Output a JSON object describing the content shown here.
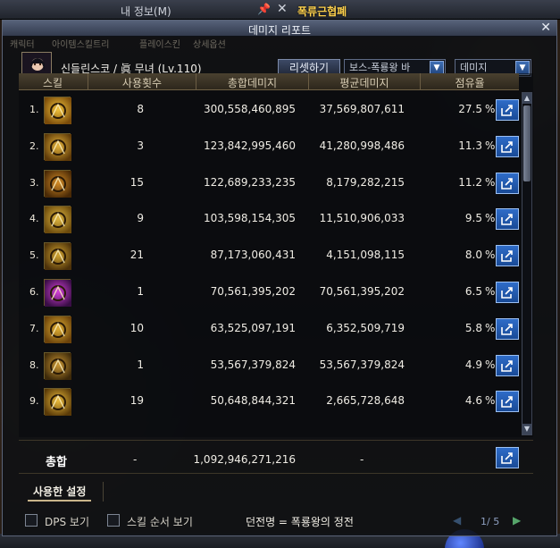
{
  "background": {
    "window_title": "내 정보(M)",
    "npc_name": "폭류근협폐",
    "ghost_tabs": [
      "캐릭터",
      "아이템스킬트리",
      "플레이스킨",
      "상세옵션"
    ]
  },
  "window": {
    "title": "데미지 리포트",
    "close": "✕"
  },
  "header": {
    "character": "신들린스코 / 眞 무녀 (Lv.110)",
    "reset_label": "리셋하기",
    "filter_value": "보스-폭룡왕 바",
    "metric_value": "데미지"
  },
  "table": {
    "columns": [
      "스킬",
      "사용횟수",
      "총합데미지",
      "평균데미지",
      "점유율"
    ],
    "rows": [
      {
        "rank": "1.",
        "icon": "skill-icon-1",
        "uses": "8",
        "total": "300,558,460,895",
        "avg": "37,569,807,611",
        "share": "27.5",
        "pct": "%"
      },
      {
        "rank": "2.",
        "icon": "skill-icon-2",
        "uses": "3",
        "total": "123,842,995,460",
        "avg": "41,280,998,486",
        "share": "11.3",
        "pct": "%"
      },
      {
        "rank": "3.",
        "icon": "skill-icon-3",
        "uses": "15",
        "total": "122,689,233,235",
        "avg": "8,179,282,215",
        "share": "11.2",
        "pct": "%"
      },
      {
        "rank": "4.",
        "icon": "skill-icon-4",
        "uses": "9",
        "total": "103,598,154,305",
        "avg": "11,510,906,033",
        "share": "9.5",
        "pct": "%"
      },
      {
        "rank": "5.",
        "icon": "skill-icon-5",
        "uses": "21",
        "total": "87,173,060,431",
        "avg": "4,151,098,115",
        "share": "8.0",
        "pct": "%"
      },
      {
        "rank": "6.",
        "icon": "skill-icon-6",
        "uses": "1",
        "total": "70,561,395,202",
        "avg": "70,561,395,202",
        "share": "6.5",
        "pct": "%"
      },
      {
        "rank": "7.",
        "icon": "skill-icon-7",
        "uses": "10",
        "total": "63,525,097,191",
        "avg": "6,352,509,719",
        "share": "5.8",
        "pct": "%"
      },
      {
        "rank": "8.",
        "icon": "skill-icon-8",
        "uses": "1",
        "total": "53,567,379,824",
        "avg": "53,567,379,824",
        "share": "4.9",
        "pct": "%"
      },
      {
        "rank": "9.",
        "icon": "skill-icon-9",
        "uses": "19",
        "total": "50,648,844,321",
        "avg": "2,665,728,648",
        "share": "4.6",
        "pct": "%"
      }
    ],
    "total": {
      "label": "총합",
      "uses": "-",
      "total": "1,092,946,271,216",
      "avg": "-"
    }
  },
  "settings_tab": "사용한 설정",
  "options": {
    "dps_label": "DPS 보기",
    "skill_order_label": "스킬 순서 보기",
    "dungeon": "던전명 = 폭룡왕의 정전",
    "page": "1/ 5"
  },
  "colors": {
    "accent_blue": "#2f6cc8",
    "header_gold": "#4a4130",
    "icon_gold": "#d8a02a",
    "icon_pink": "#c23bd1"
  }
}
